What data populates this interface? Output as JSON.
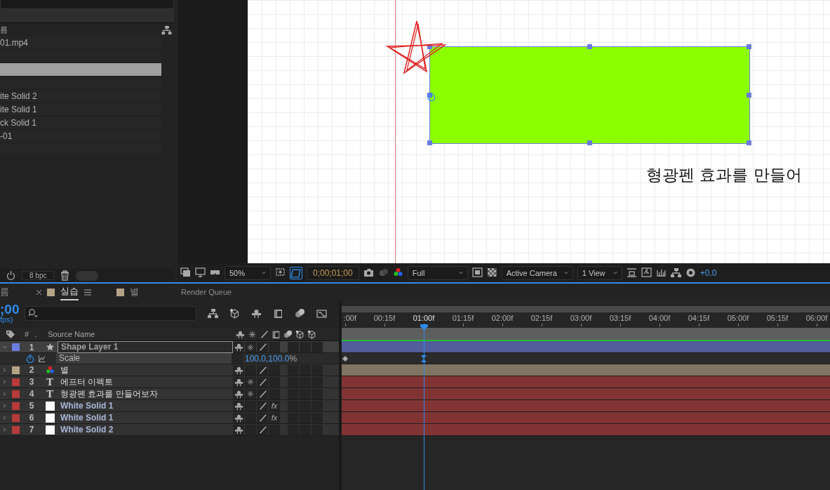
{
  "project": {
    "column_fragment": "름",
    "items": [
      {
        "name": "01.mp4",
        "selected": false
      },
      {
        "selected": false
      },
      {
        "selected": true
      },
      {
        "selected": false
      },
      {
        "name": "ite Solid 2",
        "selected": false
      },
      {
        "name": "ite Solid 1",
        "selected": false
      },
      {
        "name": "ck Solid 1",
        "selected": false
      },
      {
        "name": "-01",
        "selected": false
      },
      {
        "selected": false
      }
    ],
    "bit_depth": "8 bpc"
  },
  "viewer": {
    "canvas_text": "형광펜 효과를 만들어",
    "zoom": "50%",
    "mask_view_on": true,
    "timecode": "0;00;01;00",
    "resolution": "Full",
    "camera": "Active Camera",
    "views": "1 View",
    "exposure": "+0.0"
  },
  "timeline": {
    "panel_fragment": "름",
    "tabs": [
      {
        "label": "실습",
        "selected": true,
        "color": "#b5a386"
      },
      {
        "label": "별",
        "selected": false,
        "color": "#b5a386"
      },
      {
        "label": "Render Queue",
        "selected": false
      }
    ],
    "current_time": ";00",
    "fps": "fps)",
    "columns": [
      "#",
      ".",
      "Source Name"
    ],
    "ticks": [
      {
        "label": ":00f",
        "current": false
      },
      {
        "label": "00:15f",
        "current": false
      },
      {
        "label": "01:00f",
        "current": true
      },
      {
        "label": "01:15f",
        "current": false
      },
      {
        "label": "02:00f",
        "current": false
      },
      {
        "label": "02:15f",
        "current": false
      },
      {
        "label": "03:00f",
        "current": false
      },
      {
        "label": "03:15f",
        "current": false
      },
      {
        "label": "04:00f",
        "current": false
      },
      {
        "label": "04:15f",
        "current": false
      },
      {
        "label": "05:00f",
        "current": false
      },
      {
        "label": "05:15f",
        "current": false
      },
      {
        "label": "06:00f",
        "current": false
      }
    ],
    "layers": [
      {
        "number": "1",
        "kind": "shape",
        "name": "Shape Layer 1",
        "color": "#6b7de0",
        "selected": true,
        "expanded": true,
        "continuous_rasterize": true,
        "property": {
          "name": "Scale",
          "value": "100.0,100.0",
          "unit": "%",
          "keyframes": [
            {
              "selected": false
            },
            {
              "selected": true
            }
          ]
        }
      },
      {
        "number": "2",
        "kind": "precomp",
        "name": "별",
        "color": "#b5a386",
        "selected": false,
        "expanded": false,
        "continuous_rasterize": false
      },
      {
        "number": "3",
        "kind": "text",
        "type_icon": "T",
        "name": "에프터 이펙트",
        "color": "#b83a3a",
        "selected": false,
        "expanded": false,
        "continuous_rasterize": true
      },
      {
        "number": "4",
        "kind": "text",
        "type_icon": "T",
        "name": "형광펜 효과를 만들어보자",
        "color": "#b83a3a",
        "selected": false,
        "expanded": false,
        "continuous_rasterize": true
      },
      {
        "number": "5",
        "kind": "solid",
        "name": "White Solid 1",
        "color": "#b83a3a",
        "selected": false,
        "expanded": false,
        "continuous_rasterize": false,
        "effects": "fx"
      },
      {
        "number": "6",
        "kind": "solid",
        "name": "White Solid 1",
        "color": "#b83a3a",
        "selected": false,
        "expanded": false,
        "continuous_rasterize": false,
        "effects": "fx"
      },
      {
        "number": "7",
        "kind": "solid",
        "name": "White Solid 2",
        "color": "#b83a3a",
        "selected": false,
        "expanded": false,
        "continuous_rasterize": false
      }
    ]
  }
}
